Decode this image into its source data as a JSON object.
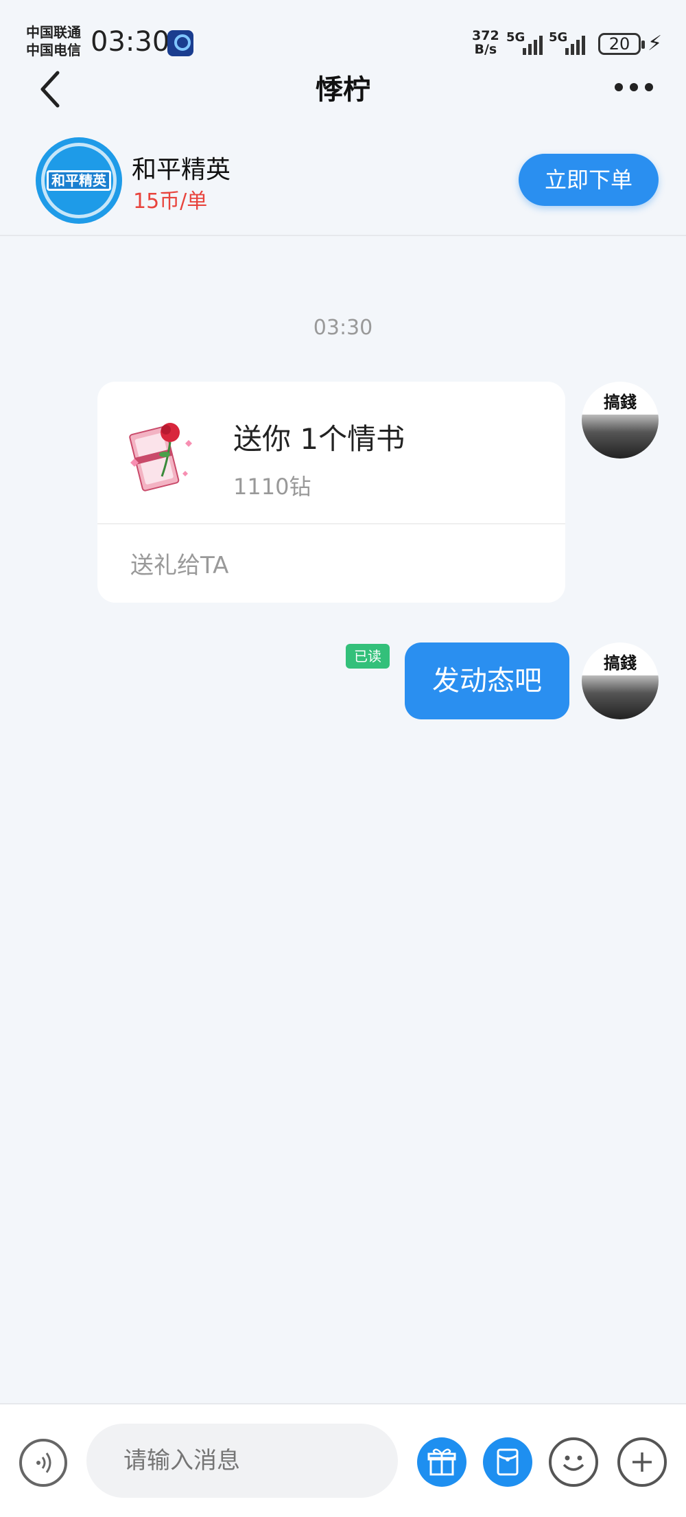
{
  "status_bar": {
    "carrier1": "中国联通",
    "carrier2": "中国电信",
    "time": "03:30",
    "net_speed_value": "372",
    "net_speed_unit": "B/s",
    "signal1": "5G",
    "signal2": "5G",
    "battery": "20"
  },
  "header": {
    "title": "悸柠"
  },
  "game": {
    "logo_text": "和平精英",
    "name": "和平精英",
    "price": "15币/单",
    "order_button": "立即下单"
  },
  "chat": {
    "timestamp": "03:30",
    "gift": {
      "title": "送你 1个情书",
      "price": "1110钻",
      "action": "送礼给TA"
    },
    "avatar_text": "搞錢",
    "read_tag": "已读",
    "message": "发动态吧"
  },
  "input": {
    "placeholder": "请输入消息"
  },
  "colors": {
    "accent": "#2a8ff0",
    "price_red": "#e8433c",
    "read_green": "#33c07a"
  }
}
